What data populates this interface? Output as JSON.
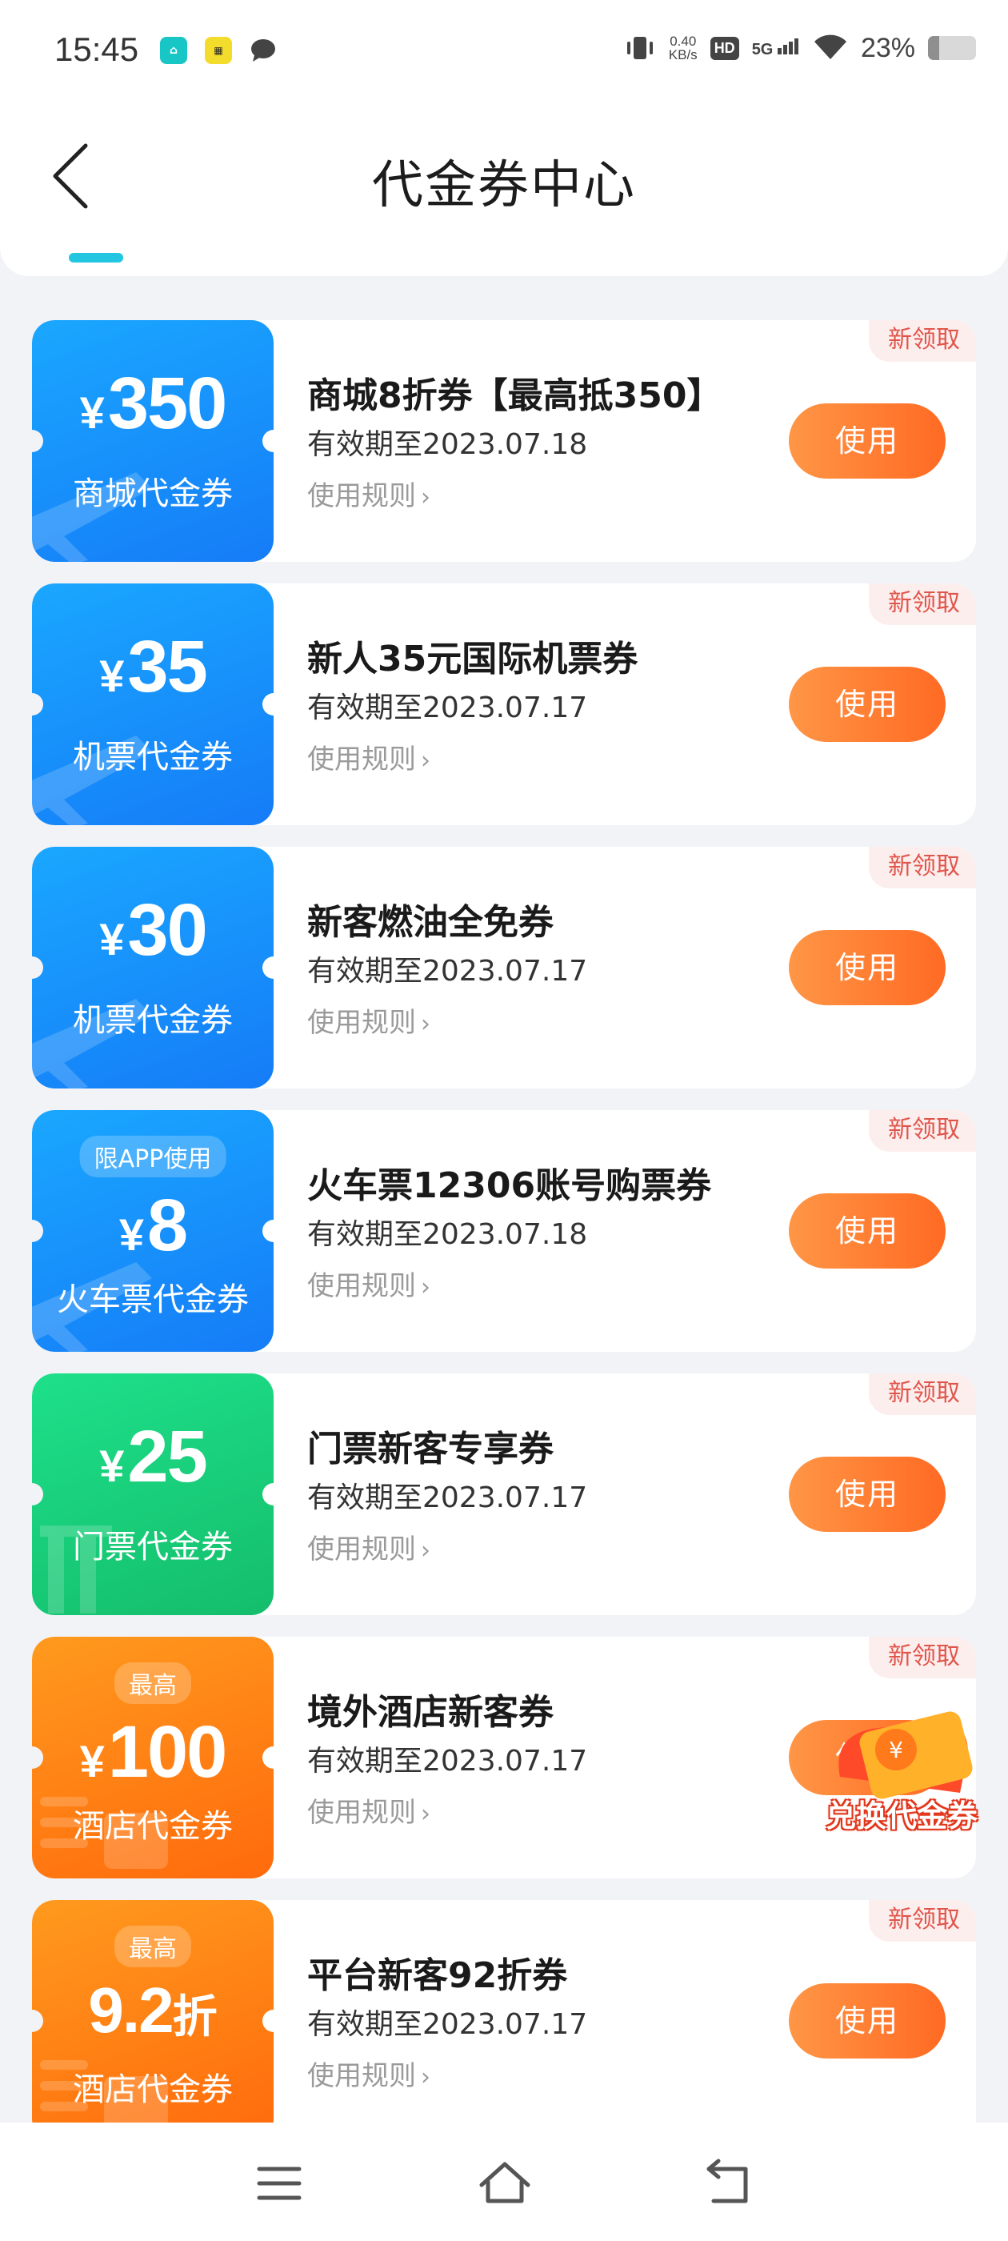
{
  "status_bar": {
    "time": "15:45",
    "network_speed_value": "0.40",
    "network_speed_unit": "KB/s",
    "hd": "HD",
    "network": "5G",
    "battery_text": "23%",
    "battery_level": 0.23,
    "notification_icons": [
      "home-app-icon",
      "yellow-app-icon",
      "message-icon"
    ]
  },
  "header": {
    "title": "代金券中心"
  },
  "coupons": [
    {
      "theme": "blue",
      "yen": "¥",
      "amount": "350",
      "type": "商城代金券",
      "title": "商城8折券【最高抵350】",
      "valid": "有效期至2023.07.18",
      "rule": "使用规则",
      "use": "使用",
      "tag": "新领取"
    },
    {
      "theme": "blue",
      "yen": "¥",
      "amount": "35",
      "type": "机票代金券",
      "title": "新人35元国际机票券",
      "valid": "有效期至2023.07.17",
      "rule": "使用规则",
      "use": "使用",
      "tag": "新领取"
    },
    {
      "theme": "blue",
      "yen": "¥",
      "amount": "30",
      "type": "机票代金券",
      "title": "新客燃油全免券",
      "valid": "有效期至2023.07.17",
      "rule": "使用规则",
      "use": "使用",
      "tag": "新领取"
    },
    {
      "theme": "blue",
      "top_tag": "限APP使用",
      "yen": "¥",
      "amount": "8",
      "type": "火车票代金券",
      "title": "火车票12306账号购票券",
      "valid": "有效期至2023.07.18",
      "rule": "使用规则",
      "use": "使用",
      "tag": "新领取"
    },
    {
      "theme": "green",
      "yen": "¥",
      "amount": "25",
      "type": "门票代金券",
      "title": "门票新客专享券",
      "valid": "有效期至2023.07.17",
      "rule": "使用规则",
      "use": "使用",
      "tag": "新领取"
    },
    {
      "theme": "orange",
      "top_tag": "最高",
      "yen": "¥",
      "amount": "100",
      "type": "酒店代金券",
      "title": "境外酒店新客券",
      "valid": "有效期至2023.07.17",
      "rule": "使用规则",
      "use": "使用",
      "tag": "新领取"
    },
    {
      "theme": "orange",
      "top_tag": "最高",
      "amount": "9.2",
      "unit": "折",
      "type": "酒店代金券",
      "title": "平台新客92折券",
      "valid": "有效期至2023.07.17",
      "rule": "使用规则",
      "use": "使用",
      "tag": "新领取"
    }
  ],
  "float_badge": {
    "label": "兑换代金券",
    "icon": "coupon-exchange-icon"
  },
  "nav": {
    "icons": [
      "menu-icon",
      "home-icon",
      "back-icon"
    ]
  },
  "colors": {
    "accent": "#22c6e0",
    "use_button": "#ff7a2e",
    "new_tag_text": "#e0554a",
    "blue_coupon": "#1a8cf8",
    "green_coupon": "#17c874",
    "orange_coupon": "#ff7d12"
  }
}
